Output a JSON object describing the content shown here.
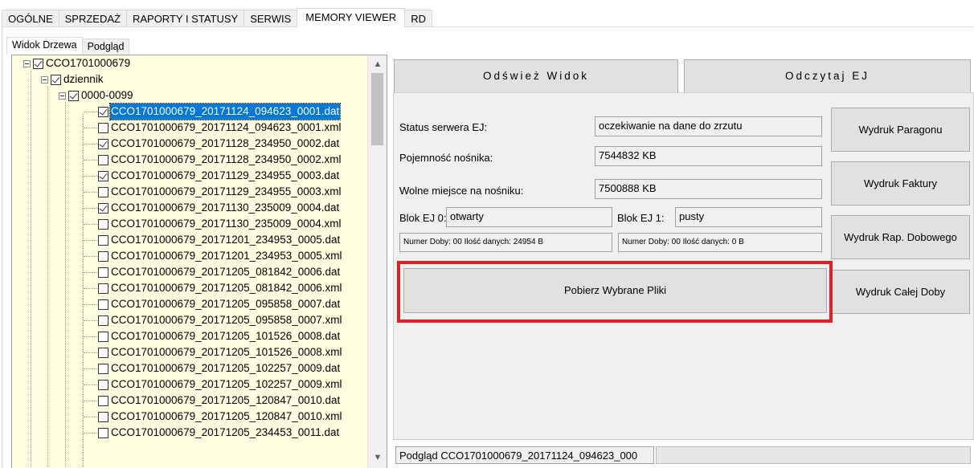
{
  "tabs": [
    {
      "label": "OGÓLNE"
    },
    {
      "label": "SPRZEDAŻ"
    },
    {
      "label": "RAPORTY I STATUSY"
    },
    {
      "label": "SERWIS"
    },
    {
      "label": "MEMORY VIEWER",
      "active": true
    },
    {
      "label": "RD"
    }
  ],
  "subtabs": [
    {
      "label": "Widok Drzewa",
      "active": true
    },
    {
      "label": "Podgląd"
    }
  ],
  "tree": {
    "root": {
      "label": "CCO1701000679",
      "checked": true
    },
    "folder": {
      "label": "dziennik",
      "checked": true
    },
    "subfolder": {
      "label": "0000-0099",
      "checked": true
    },
    "files": [
      {
        "label": "CCO1701000679_20171124_094623_0001.dat",
        "checked": true,
        "selected": true
      },
      {
        "label": "CCO1701000679_20171124_094623_0001.xml",
        "checked": false
      },
      {
        "label": "CCO1701000679_20171128_234950_0002.dat",
        "checked": true
      },
      {
        "label": "CCO1701000679_20171128_234950_0002.xml",
        "checked": false
      },
      {
        "label": "CCO1701000679_20171129_234955_0003.dat",
        "checked": true
      },
      {
        "label": "CCO1701000679_20171129_234955_0003.xml",
        "checked": false
      },
      {
        "label": "CCO1701000679_20171130_235009_0004.dat",
        "checked": true
      },
      {
        "label": "CCO1701000679_20171130_235009_0004.xml",
        "checked": false
      },
      {
        "label": "CCO1701000679_20171201_234953_0005.dat",
        "checked": false
      },
      {
        "label": "CCO1701000679_20171201_234953_0005.xml",
        "checked": false
      },
      {
        "label": "CCO1701000679_20171205_081842_0006.dat",
        "checked": false
      },
      {
        "label": "CCO1701000679_20171205_081842_0006.xml",
        "checked": false
      },
      {
        "label": "CCO1701000679_20171205_095858_0007.dat",
        "checked": false
      },
      {
        "label": "CCO1701000679_20171205_095858_0007.xml",
        "checked": false
      },
      {
        "label": "CCO1701000679_20171205_101526_0008.dat",
        "checked": false
      },
      {
        "label": "CCO1701000679_20171205_101526_0008.xml",
        "checked": false
      },
      {
        "label": "CCO1701000679_20171205_102257_0009.dat",
        "checked": false
      },
      {
        "label": "CCO1701000679_20171205_102257_0009.xml",
        "checked": false
      },
      {
        "label": "CCO1701000679_20171205_120847_0010.dat",
        "checked": false
      },
      {
        "label": "CCO1701000679_20171205_120847_0010.xml",
        "checked": false
      },
      {
        "label": "CCO1701000679_20171205_234453_0011.dat",
        "checked": false
      }
    ]
  },
  "buttons": {
    "refresh": "Odśwież Widok",
    "read_ej": "Odczytaj EJ",
    "download": "Pobierz Wybrane Pliki",
    "print_receipt": "Wydruk Paragonu",
    "print_invoice": "Wydruk Faktury",
    "print_daily": "Wydruk Rap. Dobowego",
    "print_day": "Wydruk Całej Doby"
  },
  "info": {
    "server_status_label": "Status serwera EJ:",
    "server_status_value": "oczekiwanie na dane do zrzutu",
    "capacity_label": "Pojemność nośnika:",
    "capacity_value": "7544832 KB",
    "free_label": "Wolne miejsce na nośniku:",
    "free_value": "7500888 KB",
    "block0_label": "Blok EJ 0:",
    "block0_value": "otwarty",
    "block1_label": "Blok EJ 1:",
    "block1_value": "pusty",
    "block0_detail": "Numer Doby: 00 Ilość danych: 24954 B",
    "block1_detail": "Numer Doby: 00 Ilość danych: 0 B"
  },
  "status_bar": {
    "preview_text": "Podgląd CCO1701000679_20171124_094623_000",
    "progress": 0
  },
  "colors": {
    "tree_background": "#ffffe1",
    "selection": "#0078d7",
    "highlight_box": "#e01f26"
  },
  "icons": {
    "scroll_up": "▲",
    "scroll_down": "▼"
  }
}
